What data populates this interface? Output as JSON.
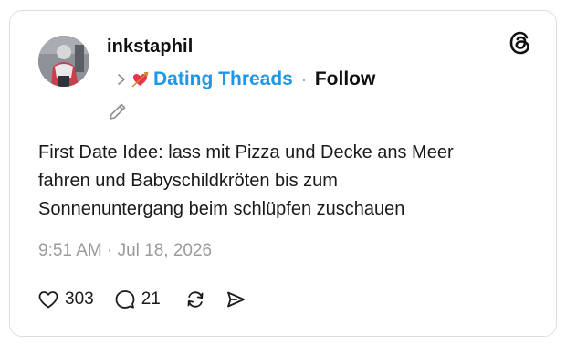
{
  "post": {
    "username": "inkstaphil",
    "topic": "Dating Threads",
    "separator": "·",
    "follow_label": "Follow",
    "text_lines": [
      "First Date Idee: lass mit Pizza und Decke ans Meer",
      "fahren und Babyschildkröten bis zum",
      "Sonnenuntergang beim schlüpfen zuschauen"
    ],
    "timestamp": "9:51 AM · Jul 18, 2026"
  },
  "actions": {
    "likes": "303",
    "replies": "21"
  },
  "icons": {
    "topic_chevron": "chevron-right-icon",
    "topic_emoji": "heart-with-arrow-icon",
    "edit": "pencil-icon",
    "brand": "threads-logo-icon",
    "like": "heart-icon",
    "reply": "comment-icon",
    "repost": "repost-icon",
    "share": "send-icon"
  },
  "colors": {
    "topic": "#1e97e6",
    "muted": "#9b9b9b",
    "text": "#101010",
    "border": "#dedede"
  }
}
